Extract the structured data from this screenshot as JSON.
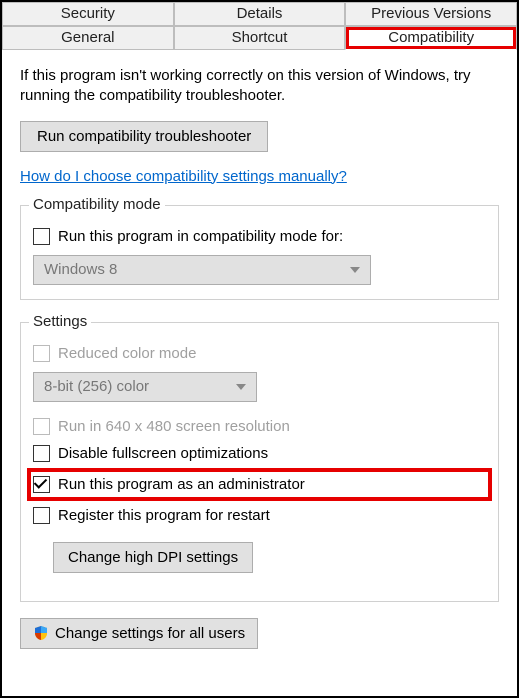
{
  "tabs": {
    "row1": [
      "Security",
      "Details",
      "Previous Versions"
    ],
    "row2": [
      "General",
      "Shortcut",
      "Compatibility"
    ],
    "active": "Compatibility",
    "highlighted": "Compatibility"
  },
  "intro": "If this program isn't working correctly on this version of Windows, try running the compatibility troubleshooter.",
  "run_troubleshooter_btn": "Run compatibility troubleshooter",
  "manual_link": "How do I choose compatibility settings manually?",
  "compat_mode": {
    "legend": "Compatibility mode",
    "checkbox_label": "Run this program in compatibility mode for:",
    "checkbox_checked": false,
    "dropdown_value": "Windows 8"
  },
  "settings": {
    "legend": "Settings",
    "reduced_color": {
      "label": "Reduced color mode",
      "checked": false,
      "enabled": false,
      "dropdown_value": "8-bit (256) color"
    },
    "run_640x480": {
      "label": "Run in 640 x 480 screen resolution",
      "checked": false,
      "enabled": false
    },
    "disable_fullscreen_opt": {
      "label": "Disable fullscreen optimizations",
      "checked": false,
      "enabled": true
    },
    "run_as_admin": {
      "label": "Run this program as an administrator",
      "checked": true,
      "enabled": true,
      "emphasized": true
    },
    "register_restart": {
      "label": "Register this program for restart",
      "checked": false,
      "enabled": true
    },
    "change_dpi_btn": "Change high DPI settings"
  },
  "change_all_users_btn": "Change settings for all users"
}
